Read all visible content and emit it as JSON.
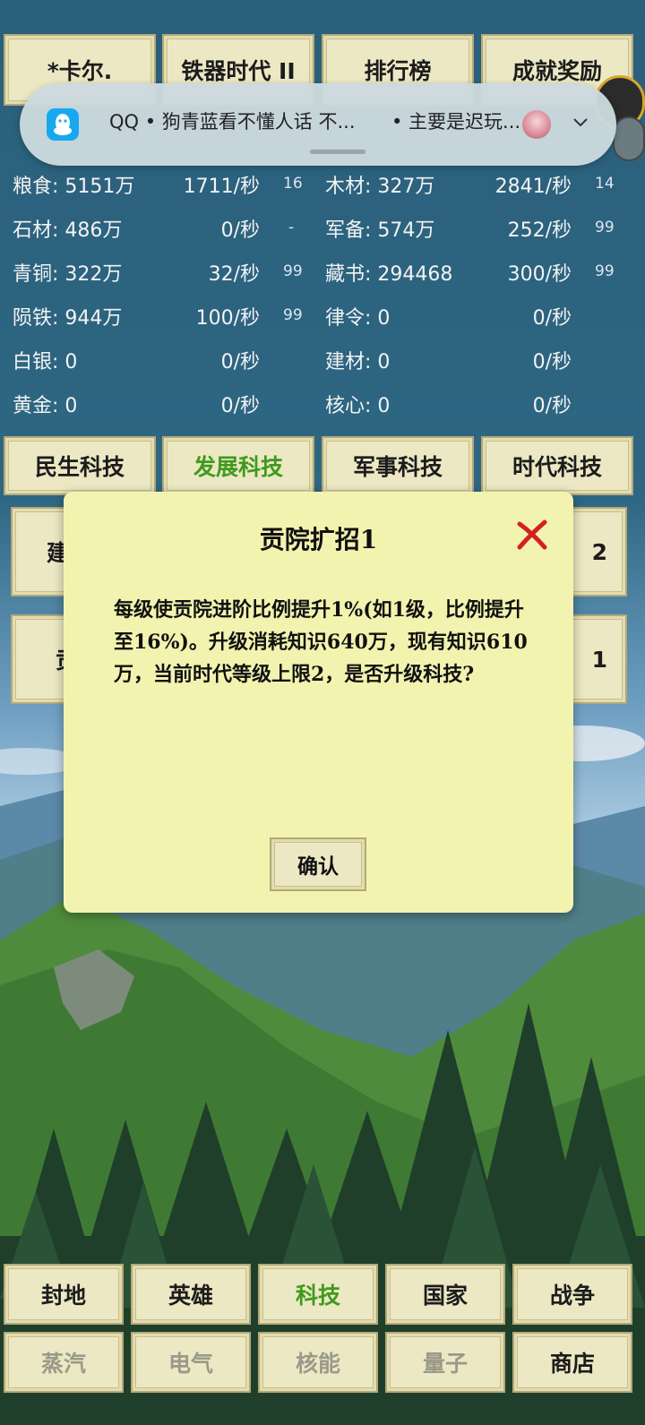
{
  "top_tabs": [
    "*卡尔.",
    "铁器时代 II",
    "排行榜",
    "成就奖励"
  ],
  "notification": {
    "app": "QQ",
    "sender": "狗青蓝看不懂人话",
    "preview": "不...",
    "extra": "• 主要是迟玩...",
    "separator": "•",
    "full_text": "QQ • 狗青蓝看不懂人话  不..."
  },
  "resources_left": [
    {
      "label": "粮食: 5151万",
      "rate": "1711/秒",
      "level": "16"
    },
    {
      "label": "石材: 486万",
      "rate": "0/秒",
      "level": "-"
    },
    {
      "label": "青铜: 322万",
      "rate": "32/秒",
      "level": "99"
    },
    {
      "label": "陨铁: 944万",
      "rate": "100/秒",
      "level": "99"
    },
    {
      "label": "白银: 0",
      "rate": "0/秒",
      "level": ""
    },
    {
      "label": "黄金: 0",
      "rate": "0/秒",
      "level": ""
    }
  ],
  "resources_right": [
    {
      "label": "木材: 327万",
      "rate": "2841/秒",
      "level": "14"
    },
    {
      "label": "军备: 574万",
      "rate": "252/秒",
      "level": "99"
    },
    {
      "label": "藏书: 294468",
      "rate": "300/秒",
      "level": "99"
    },
    {
      "label": "律令: 0",
      "rate": "0/秒",
      "level": ""
    },
    {
      "label": "建材: 0",
      "rate": "0/秒",
      "level": ""
    },
    {
      "label": "核心: 0",
      "rate": "0/秒",
      "level": ""
    }
  ],
  "tech_tabs": [
    "民生科技",
    "发展科技",
    "军事科技",
    "时代科技"
  ],
  "tech_tabs_active": 1,
  "behind_cards": [
    "建",
    "2",
    "贡",
    "1"
  ],
  "dialog": {
    "title": "贡院扩招1",
    "body": "每级使贡院进阶比例提升1%(如1级，比例提升至16%)。升级消耗知识640万，现有知识610万，当前时代等级上限2，是否升级科技?",
    "confirm": "确认"
  },
  "bottom_row1": [
    "封地",
    "英雄",
    "科技",
    "国家",
    "战争"
  ],
  "bottom_row2": [
    "蒸汽",
    "电气",
    "核能",
    "量子",
    "商店"
  ],
  "bottom_active": 2,
  "colors": {
    "parchment": "#ece8c4",
    "dialog_bg": "#f3f3b0",
    "active_green": "#3f9a1e",
    "dim_text": "#9a9a8a"
  }
}
